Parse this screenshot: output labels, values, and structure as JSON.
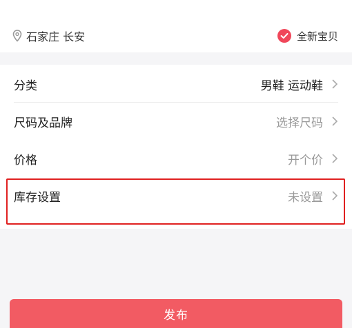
{
  "location": {
    "text": "石家庄 长安"
  },
  "condition_tag": {
    "label": "全新宝贝",
    "checked": true
  },
  "rows": [
    {
      "label": "分类",
      "value": "男鞋 运动鞋",
      "value_filled": true
    },
    {
      "label": "尺码及品牌",
      "value": "选择尺码",
      "value_filled": false
    },
    {
      "label": "价格",
      "value": "开个价",
      "value_filled": false
    },
    {
      "label": "库存设置",
      "value": "未设置",
      "value_filled": false
    }
  ],
  "publish_button": {
    "label": "发布"
  },
  "colors": {
    "accent": "#f25b63",
    "check": "#f0475a",
    "highlight": "#e02020"
  }
}
